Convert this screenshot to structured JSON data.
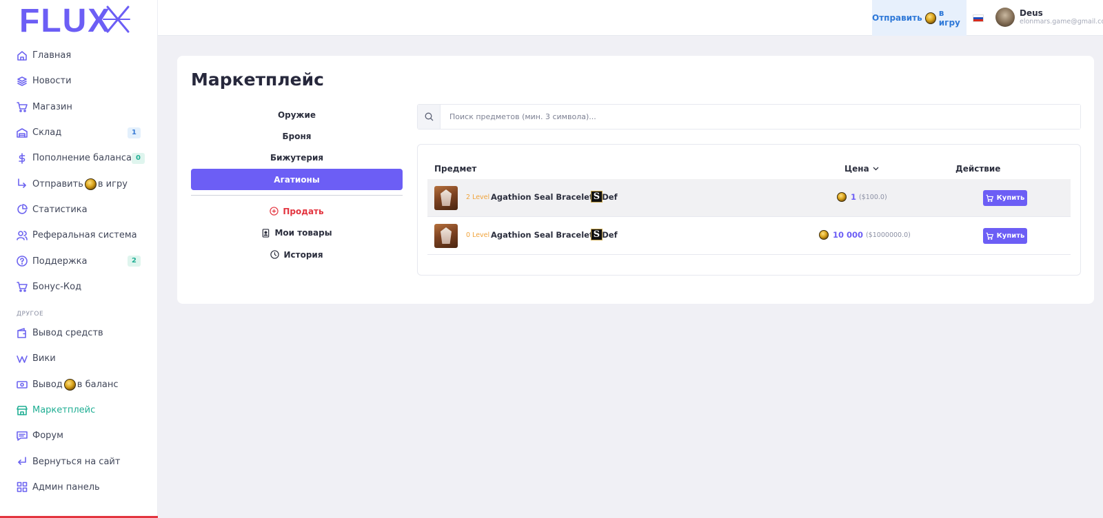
{
  "brand": {
    "logo_text": "FLUX",
    "accent": "#6c5ef5",
    "active_nav": "#1fae93",
    "danger": "#e3343f"
  },
  "sidebar": {
    "items": [
      {
        "label": "Главная",
        "icon": "home-icon"
      },
      {
        "label": "Новости",
        "icon": "layers-icon"
      },
      {
        "label": "Магазин",
        "icon": "cart-icon"
      },
      {
        "label": "Склад",
        "icon": "warehouse-icon",
        "badge": "1"
      },
      {
        "label": "Пополнение баланса",
        "icon": "dollar-icon",
        "badge": "0"
      },
      {
        "label_prefix": "Отправить",
        "label_suffix": "в игру",
        "icon": "arrow-turn-icon"
      },
      {
        "label": "Статистика",
        "icon": "pie-chart-icon"
      },
      {
        "label": "Реферальная система",
        "icon": "users-icon"
      },
      {
        "label": "Поддержка",
        "icon": "help-icon",
        "badge": "2"
      },
      {
        "label": "Бонус-Код",
        "icon": "cart-icon"
      }
    ],
    "section_label": "ДРУГОЕ",
    "other_items": [
      {
        "label": "Вывод средств",
        "icon": "wallet-icon"
      },
      {
        "label": "Вики",
        "icon": "wiki-icon"
      },
      {
        "label_prefix": "Вывод",
        "label_suffix": "в баланс",
        "icon": "cash-icon"
      },
      {
        "label": "Маркетплейс",
        "icon": "store-icon",
        "active": true
      },
      {
        "label": "Форум",
        "icon": "forum-icon"
      },
      {
        "label": "Вернуться на сайт",
        "icon": "return-icon"
      },
      {
        "label": "Админ панель",
        "icon": "grid-icon"
      }
    ]
  },
  "header": {
    "send_prefix": "Отправить",
    "send_suffix": "в игру",
    "user_name": "Deus",
    "user_email": "elonmars.game@gmail.com"
  },
  "main": {
    "title": "Маркетплейс",
    "categories": [
      "Оружие",
      "Броня",
      "Бижутерия",
      "Агатионы"
    ],
    "active_category": "Агатионы",
    "actions": {
      "sell": "Продать",
      "my_items": "Мои товары",
      "history": "История"
    },
    "search": {
      "placeholder": "Поиск предметов (мин. 3 символа)..."
    },
    "table": {
      "headers": {
        "item": "Предмет",
        "price": "Цена",
        "action": "Действие"
      },
      "rows": [
        {
          "level": "2 Level",
          "name": "Agathion Seal Bracelet - Def",
          "grade": "S",
          "price": "1",
          "usd": "($100.0)",
          "buy": "Купить"
        },
        {
          "level": "0 Level",
          "name": "Agathion Seal Bracelet - Def",
          "grade": "S",
          "price": "10 000",
          "usd": "($1000000.0)",
          "buy": "Купить"
        }
      ]
    }
  }
}
